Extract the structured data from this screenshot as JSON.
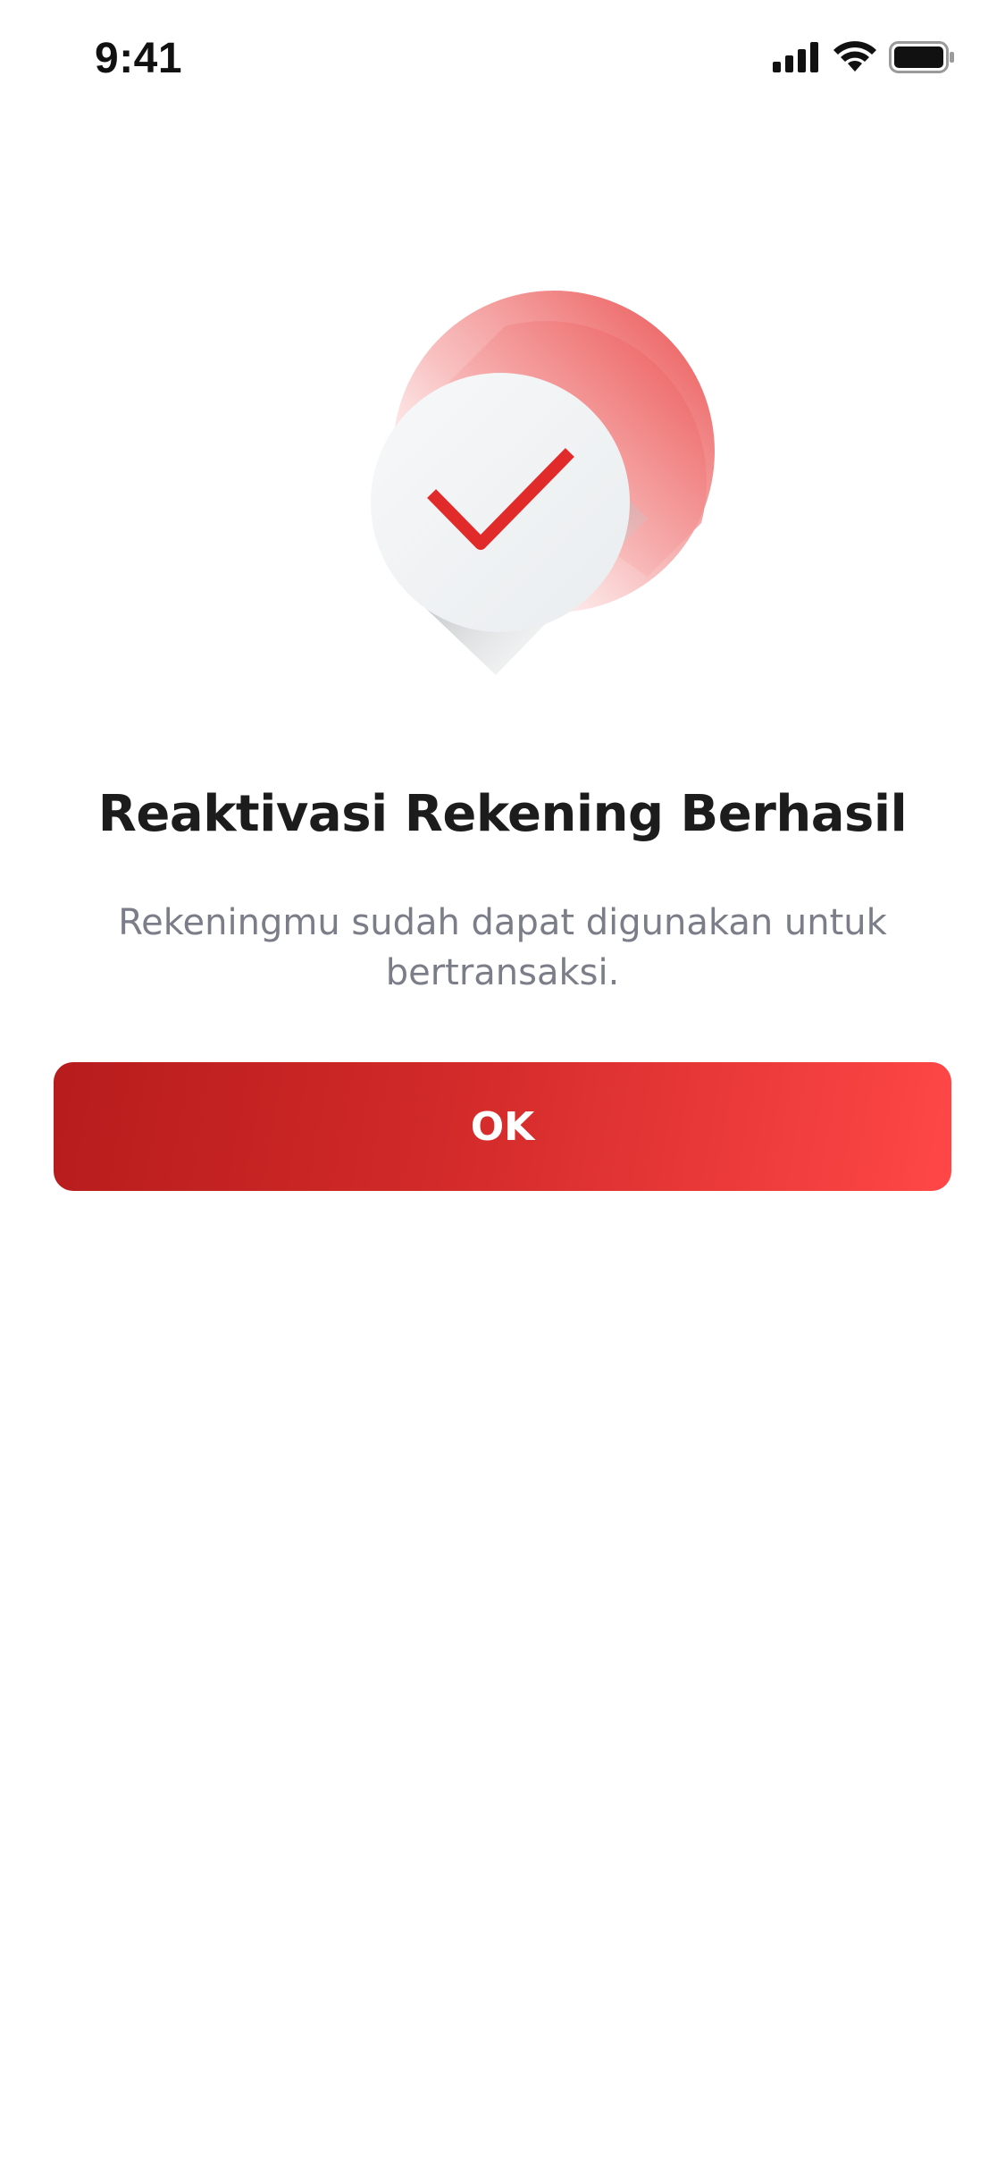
{
  "status_bar": {
    "time": "9:41",
    "icons": [
      "cellular-signal-icon",
      "wifi-icon",
      "battery-icon"
    ]
  },
  "illustration": {
    "icon": "success-check-icon",
    "colors": {
      "accent_red": "#e53935",
      "disc_light": "#f4f5f6",
      "shadow": "#5f6d72"
    }
  },
  "message": {
    "title": "Reaktivasi Rekening Berhasil",
    "subtitle_line1": "Rekeningmu sudah dapat digunakan untuk",
    "subtitle_line2": "bertransaksi."
  },
  "actions": {
    "ok_label": "OK"
  },
  "colors": {
    "button_start": "#b71c1c",
    "button_end": "#ff4747",
    "title": "#1c1c1c",
    "subtitle": "#7b7e88"
  }
}
